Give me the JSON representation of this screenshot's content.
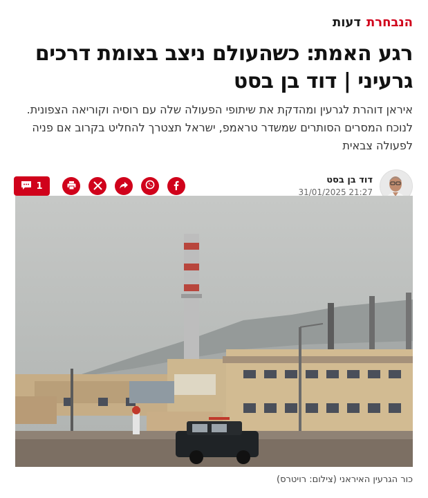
{
  "header": {
    "brand": "הנבחרת",
    "section": "דעות"
  },
  "article": {
    "title": "רגע האמת: כשהעולם ניצב בצומת דרכים גרעיני | דוד בן בסט",
    "lead": "איראן דוהרת לגרעין ומהדקת את שיתופי הפעולה שלה עם רוסיה וקוריאה הצפונית. לנוכח המסרים הסותרים שמשדר טראמפ, ישראל תצטרך להחליט בקרוב אם פניה לפעולה צבאית",
    "author": "דוד בן בסט",
    "date": "31/01/2025 21:27",
    "comments_count": "1",
    "image_caption": "כור הגרעין האיראני (צילום: רויטרס)"
  },
  "share_icons": [
    "facebook-icon",
    "whatsapp-icon",
    "share-icon",
    "x-icon",
    "print-icon"
  ],
  "colors": {
    "accent": "#d0021b",
    "text": "#111111"
  }
}
